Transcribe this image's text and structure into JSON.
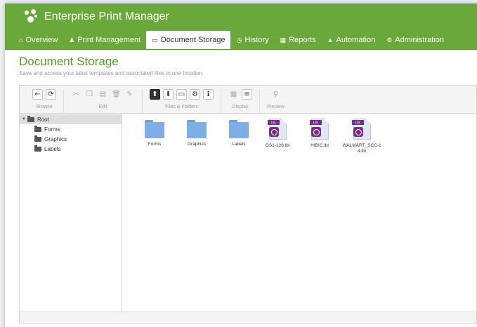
{
  "app": {
    "title": "Enterprise Print Manager"
  },
  "nav": {
    "items": [
      {
        "label": "Overview",
        "icon": "home-icon",
        "glyph": "⌂"
      },
      {
        "label": "Print Management",
        "icon": "print-management-icon",
        "glyph": "♟"
      },
      {
        "label": "Document Storage",
        "icon": "storage-icon",
        "glyph": "▭",
        "active": true
      },
      {
        "label": "History",
        "icon": "history-icon",
        "glyph": "◷"
      },
      {
        "label": "Reports",
        "icon": "reports-icon",
        "glyph": "▦"
      },
      {
        "label": "Automation",
        "icon": "automation-icon",
        "glyph": "▲"
      },
      {
        "label": "Administration",
        "icon": "administration-icon",
        "glyph": "⚙"
      }
    ]
  },
  "page": {
    "title": "Document Storage",
    "subtitle": "Save and access your label templates and associated files in one location."
  },
  "toolbar": {
    "groups": [
      {
        "label": "Browse",
        "buttons": [
          {
            "icon": "back-icon",
            "glyph": "←",
            "state": "on"
          },
          {
            "icon": "refresh-icon",
            "glyph": "⟳",
            "state": "on"
          }
        ]
      },
      {
        "label": "Edit",
        "buttons": [
          {
            "icon": "cut-icon",
            "glyph": "✂"
          },
          {
            "icon": "copy-icon",
            "glyph": "❐"
          },
          {
            "icon": "paste-icon",
            "glyph": "▤"
          },
          {
            "icon": "delete-icon",
            "glyph": "🗑"
          },
          {
            "icon": "rename-icon",
            "glyph": "✎"
          }
        ]
      },
      {
        "label": "Files & Folders",
        "buttons": [
          {
            "icon": "upload-icon",
            "glyph": "⬆",
            "state": "dark"
          },
          {
            "icon": "download-icon",
            "glyph": "⬇",
            "state": "on"
          },
          {
            "icon": "new-folder-icon",
            "glyph": "▭",
            "state": "on"
          },
          {
            "icon": "settings-icon",
            "glyph": "⚙",
            "state": "on"
          },
          {
            "icon": "info-icon",
            "glyph": "ℹ",
            "state": "on"
          }
        ]
      },
      {
        "label": "Display",
        "buttons": [
          {
            "icon": "grid-view-icon",
            "glyph": "▦"
          },
          {
            "icon": "list-view-icon",
            "glyph": "≡",
            "state": "on"
          }
        ]
      },
      {
        "label": "Preview",
        "buttons": [
          {
            "icon": "search-icon",
            "glyph": "⚲"
          }
        ]
      }
    ]
  },
  "tree": {
    "root": "Root",
    "children": [
      "Forms",
      "Graphics",
      "Labels"
    ]
  },
  "files": [
    {
      "name": "Forms",
      "kind": "folder"
    },
    {
      "name": "Graphics",
      "kind": "folder"
    },
    {
      "name": "Labels",
      "kind": "folder"
    },
    {
      "name": "GS1-128.lbl",
      "kind": "label",
      "band": "LBL"
    },
    {
      "name": "HIBIC.lbl",
      "kind": "label",
      "band": "LBL"
    },
    {
      "name": "WALMART_SCC-14.lbl",
      "kind": "label",
      "band": "LBL"
    }
  ],
  "colors": {
    "brand": "#6aa83b",
    "title": "#5a9a2a",
    "folder": "#7eaee3",
    "label_file": "#7b2c87"
  }
}
